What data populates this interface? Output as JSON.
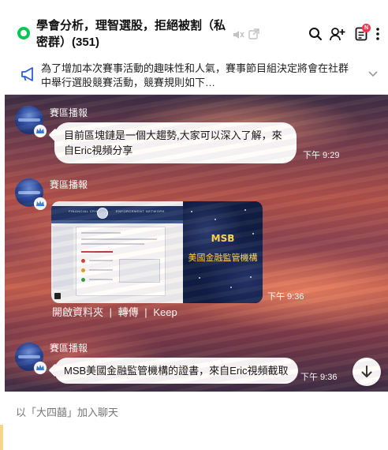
{
  "header": {
    "title": "學會分析，理智選股，拒絕被割（私密群）(351)",
    "notification_badge": "N"
  },
  "announcement": {
    "text": "為了增加本次賽事活動的趣味性和人氣，賽事節目組決定將會在社群中舉行選股競賽活動，競賽規則如下…"
  },
  "messages": [
    {
      "sender": "賽區播報",
      "type": "text",
      "text": "目前區塊鏈是一個大趨勢,大家可以深入了解，來自Eric視頻分享",
      "time": "下午 9:29"
    },
    {
      "sender": "賽區播報",
      "type": "image",
      "image": {
        "banner_left": "FINANCIAL CRIMES",
        "banner_right": "ENFORCEMENT NETWORK",
        "title": "MSB",
        "caption": "美國金融監管機構"
      },
      "time": "下午 9:36",
      "actions": [
        "開啟資料夾",
        "轉傳",
        "Keep"
      ],
      "action_separator": "|"
    },
    {
      "sender": "賽區播報",
      "type": "text",
      "text": "MSB美國金融監管機構的證書，來自Eric視頻截取",
      "time": "下午 9:36"
    }
  ],
  "composer": {
    "placeholder": "以「大四囍」加入聊天"
  },
  "colors": {
    "accent_green": "#06c755",
    "badge_red": "#ff334b"
  }
}
